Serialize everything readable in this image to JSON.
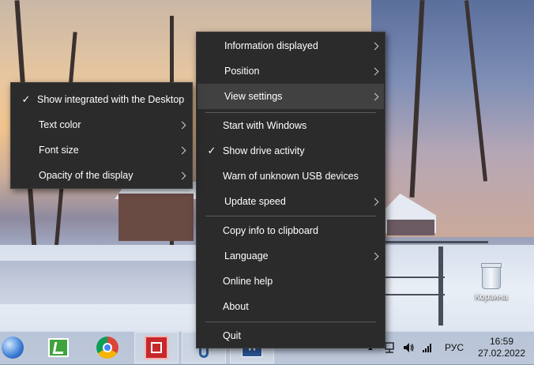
{
  "desktop": {
    "recycle_bin_label": "Корзина"
  },
  "main_menu": {
    "items": [
      {
        "label": "Information displayed",
        "submenu": true
      },
      {
        "label": "Position",
        "submenu": true
      },
      {
        "label": "View settings",
        "submenu": true,
        "highlighted": true
      },
      {
        "label": "Start with Windows"
      },
      {
        "label": "Show drive activity",
        "checked": true
      },
      {
        "label": "Warn of unknown USB devices"
      },
      {
        "label": "Update speed",
        "submenu": true
      },
      {
        "label": "Copy info to clipboard"
      },
      {
        "label": "Language",
        "submenu": true
      },
      {
        "label": "Online help"
      },
      {
        "label": "About"
      },
      {
        "label": "Quit"
      }
    ],
    "check_glyph": "✓"
  },
  "sub_menu": {
    "items": [
      {
        "label": "Show integrated with the Desktop",
        "checked": true
      },
      {
        "label": "Text color",
        "submenu": true
      },
      {
        "label": "Font size",
        "submenu": true
      },
      {
        "label": "Opacity of the display",
        "submenu": true
      }
    ],
    "check_glyph": "✓"
  },
  "taskbar": {
    "apps": [
      "network-globe-icon",
      "green-app-icon",
      "chrome-icon",
      "red-app-icon",
      "usb-app-icon",
      "word-icon"
    ],
    "tray": {
      "overflow_glyph": "▲",
      "language": "РУС"
    },
    "clock": {
      "time": "16:59",
      "date": "27.02.2022"
    }
  },
  "colors": {
    "menu_bg": "#2b2b2b",
    "menu_hover": "#414141",
    "menu_text": "#ffffff"
  }
}
